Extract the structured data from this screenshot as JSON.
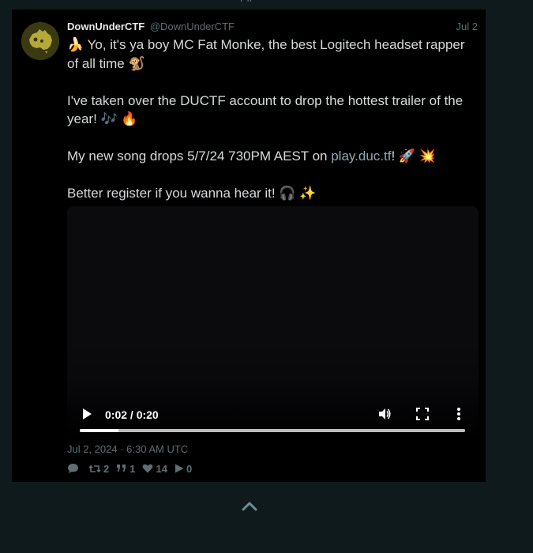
{
  "tweet": {
    "display_name": "DownUnderCTF",
    "username": "@DownUnderCTF",
    "date_short": "Jul 2",
    "body": {
      "line1_text": "Yo, it's ya boy MC Fat Monke, the best Logitech headset rapper of all time",
      "line1_prefix_emoji": "🍌",
      "line1_suffix_emoji": "🐒",
      "line2_text": "I've taken over the DUCTF account to drop the hottest trailer of the year!",
      "line2_emoji": "🎶 🔥",
      "line3_pre": "My new song drops 5/7/24 730PM AEST on ",
      "line3_link": "play.duc.tf",
      "line3_post": "!",
      "line3_emoji": "🚀 💥",
      "line4_text": "Better register if you wanna hear it!",
      "line4_emoji": "🎧 ✨"
    },
    "timestamp": "Jul 2, 2024 · 6:30 AM UTC",
    "stats": {
      "retweets": "2",
      "quotes": "1",
      "likes": "14",
      "plays": "0"
    },
    "link_color": "#8fa9b4"
  },
  "video": {
    "time_display": "0:02 / 0:20",
    "progress_fraction": 0.1
  },
  "icons": {
    "reply": "speech-bubble-icon",
    "retweet": "retweet-icon",
    "quote": "quote-icon",
    "like": "heart-icon",
    "play": "play-icon",
    "scroll_top": "chevron-up-icon"
  }
}
